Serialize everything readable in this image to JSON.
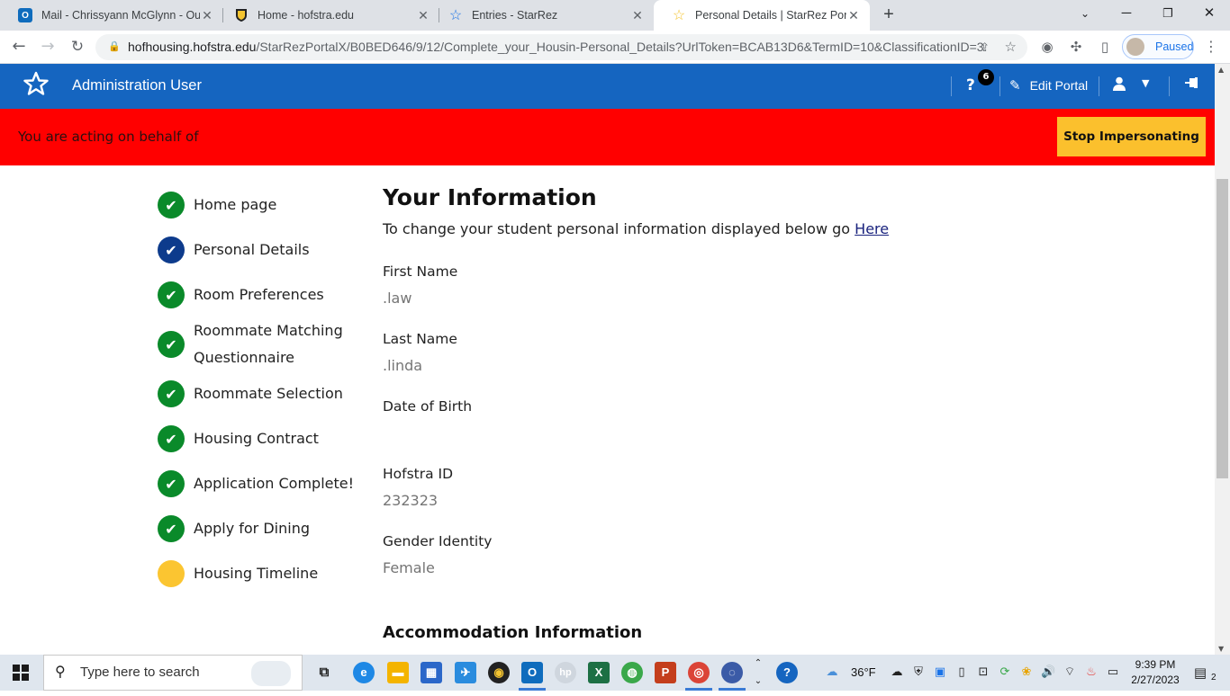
{
  "browser": {
    "tabs": [
      {
        "title": "Mail - Chrissyann McGlynn - Out",
        "icon": "outlook-icon",
        "active": false
      },
      {
        "title": "Home - hofstra.edu",
        "icon": "hofstra-shield-icon",
        "active": false
      },
      {
        "title": "Entries - StarRez",
        "icon": "starrez-star-icon",
        "active": false
      },
      {
        "title": "Personal Details | StarRez Portal",
        "icon": "starrez-star-yellow-icon",
        "active": true
      }
    ],
    "url_host": "hofhousing.hofstra.edu",
    "url_path": "/StarRezPortalX/B0BED646/9/12/Complete_your_Housin-Personal_Details?UrlToken=BCAB13D6&TermID=10&ClassificationID=3",
    "profile_status": "Paused"
  },
  "portal": {
    "user_name": "Administration User",
    "help_badge": "6",
    "edit_portal_label": "Edit Portal",
    "header_color": "#1565c0"
  },
  "impersonation": {
    "message": "You are acting on behalf of",
    "button_label": "Stop Impersonating",
    "bar_color": "#ff0000",
    "button_color": "#fbc02d"
  },
  "steps": [
    {
      "label": "Home page",
      "status": "done"
    },
    {
      "label": "Personal Details",
      "status": "current"
    },
    {
      "label": "Room Preferences",
      "status": "done"
    },
    {
      "label": "Roommate Matching Questionnaire",
      "status": "done"
    },
    {
      "label": "Roommate Selection",
      "status": "done"
    },
    {
      "label": "Housing Contract",
      "status": "done"
    },
    {
      "label": "Application Complete!",
      "status": "done"
    },
    {
      "label": "Apply for Dining",
      "status": "done"
    },
    {
      "label": "Housing Timeline",
      "status": "pending"
    }
  ],
  "main": {
    "title": "Your Information",
    "intro_text": "To change your student personal information displayed below go",
    "intro_link": "Here",
    "fields": [
      {
        "label": "First Name",
        "value": ".law"
      },
      {
        "label": "Last Name",
        "value": ".linda"
      },
      {
        "label": "Date of Birth",
        "value": ""
      },
      {
        "label": "Hofstra ID",
        "value": "232323"
      },
      {
        "label": "Gender Identity",
        "value": "Female"
      }
    ],
    "section2_title": "Accommodation Information"
  },
  "taskbar": {
    "search_placeholder": "Type here to search",
    "weather": "36°F",
    "time": "9:39 PM",
    "date": "2/27/2023",
    "notifications": "2"
  }
}
